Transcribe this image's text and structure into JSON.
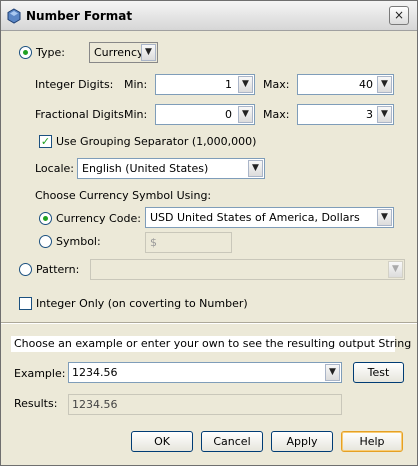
{
  "window": {
    "title": "Number Format",
    "close_symbol": "×"
  },
  "type_row": {
    "label": "Type:",
    "value": "Currency"
  },
  "integer_digits": {
    "label": "Integer Digits:",
    "min_label": "Min:",
    "min_value": "1",
    "max_label": "Max:",
    "max_value": "40"
  },
  "fractional_digits": {
    "label": "Fractional Digits:",
    "min_label": "Min:",
    "min_value": "0",
    "max_label": "Max:",
    "max_value": "3"
  },
  "grouping": {
    "label": "Use Grouping Separator (1,000,000)",
    "checked": true
  },
  "locale": {
    "label": "Locale:",
    "value": "English (United States)"
  },
  "currency": {
    "heading": "Choose Currency Symbol Using:",
    "code_label": "Currency Code:",
    "code_value": "USD United States of America, Dollars",
    "symbol_label": "Symbol:",
    "symbol_value": "$"
  },
  "pattern": {
    "label": "Pattern:",
    "value": ""
  },
  "integer_only": {
    "label": "Integer Only (on coverting to Number)",
    "checked": false
  },
  "example_section": {
    "hint": "Choose an example or enter your own to see the resulting output String",
    "example_label": "Example:",
    "example_value": "1234.56",
    "test_button": "Test",
    "results_label": "Results:",
    "results_value": "1234.56"
  },
  "buttons": {
    "ok": "OK",
    "cancel": "Cancel",
    "apply": "Apply",
    "help": "Help"
  },
  "icons": {
    "dropdown": "▼",
    "check": "✓"
  }
}
